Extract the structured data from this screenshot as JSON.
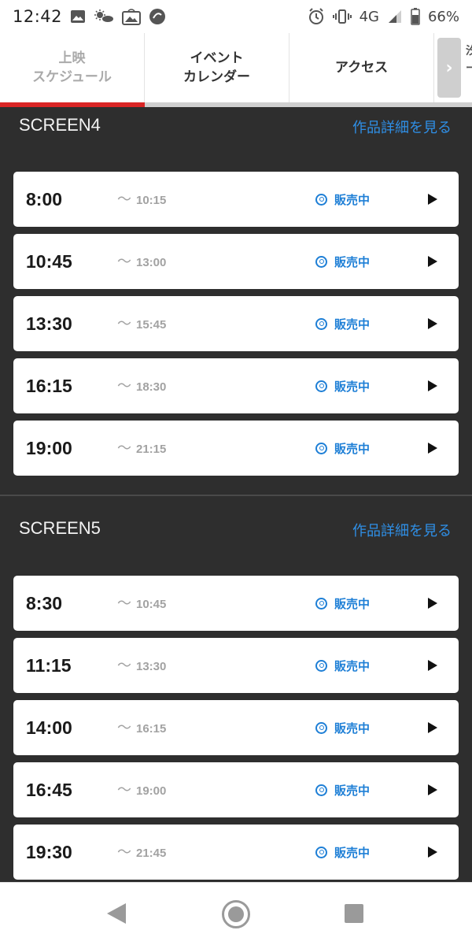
{
  "status_bar": {
    "time": "12:42",
    "network": "4G",
    "battery": "66%"
  },
  "tabs": [
    {
      "line1": "上映",
      "line2": "スケジュール",
      "active": true
    },
    {
      "line1": "イベント",
      "line2": "カレンダー",
      "active": false
    },
    {
      "line1": "アクセス",
      "line2": "",
      "active": false
    }
  ],
  "tab_overflow": {
    "line1": "汐",
    "line2": "ー"
  },
  "sections": [
    {
      "screen_name": "SCREEN4",
      "detail_link": "作品詳細を見る",
      "showings": [
        {
          "start": "8:00",
          "end": "10:15",
          "status": "販売中"
        },
        {
          "start": "10:45",
          "end": "13:00",
          "status": "販売中"
        },
        {
          "start": "13:30",
          "end": "15:45",
          "status": "販売中"
        },
        {
          "start": "16:15",
          "end": "18:30",
          "status": "販売中"
        },
        {
          "start": "19:00",
          "end": "21:15",
          "status": "販売中"
        }
      ]
    },
    {
      "screen_name": "SCREEN5",
      "detail_link": "作品詳細を見る",
      "showings": [
        {
          "start": "8:30",
          "end": "10:45",
          "status": "販売中"
        },
        {
          "start": "11:15",
          "end": "13:30",
          "status": "販売中"
        },
        {
          "start": "14:00",
          "end": "16:15",
          "status": "販売中"
        },
        {
          "start": "16:45",
          "end": "19:00",
          "status": "販売中"
        },
        {
          "start": "19:30",
          "end": "21:45",
          "status": "販売中"
        }
      ]
    }
  ],
  "range_separator": "〜",
  "colors": {
    "accent_red": "#d92525",
    "link_blue": "#2f8fe6",
    "status_blue": "#1e7fd6",
    "background_dark": "#2e2e2e"
  }
}
